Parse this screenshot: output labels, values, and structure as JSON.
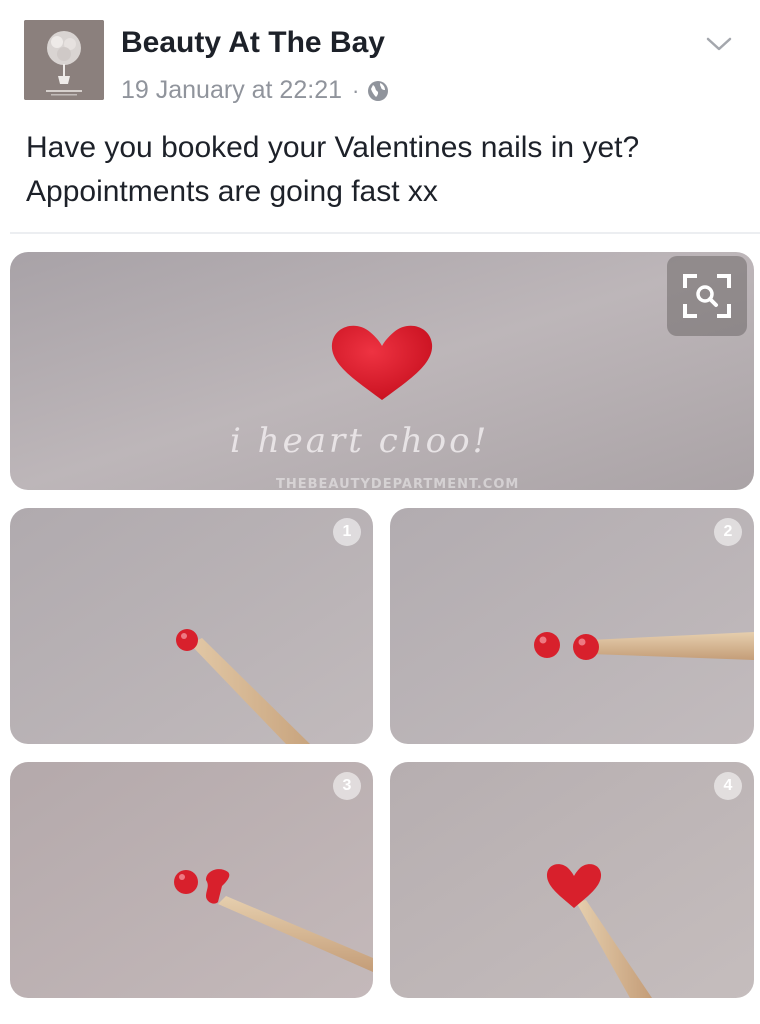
{
  "post": {
    "page_name": "Beauty At The Bay",
    "timestamp": "19 January at 22:21",
    "separator": "·",
    "privacy_icon": "globe-icon",
    "menu_icon": "chevron-down-icon",
    "text_line1": "Have you booked your Valentines nails in yet?",
    "text_line2": "Appointments are going fast xx"
  },
  "photo": {
    "caption": "i heart choo!",
    "watermark": "THEBEAUTYDEPARTMENT.COM",
    "zoom_icon": "visual-search-icon",
    "steps": [
      "1",
      "2",
      "3",
      "4"
    ]
  },
  "colors": {
    "text": "#1d2129",
    "meta": "#90949c",
    "heart_red": "#e0202e",
    "backdrop": "#b9b3b6"
  }
}
